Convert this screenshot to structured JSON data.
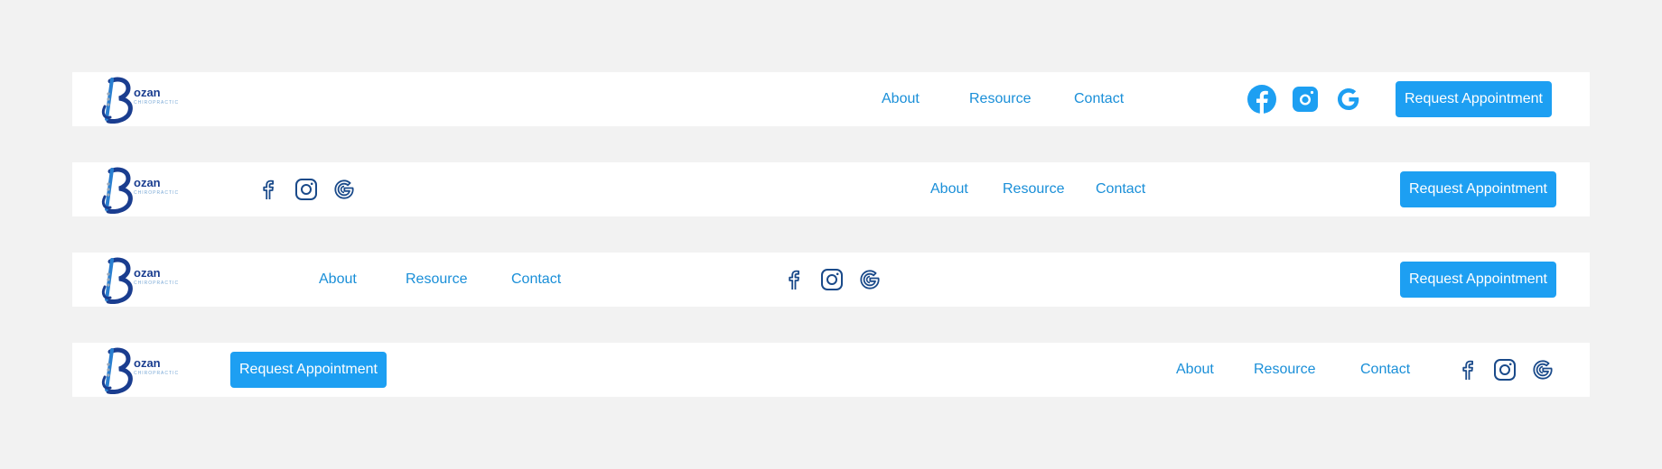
{
  "brand": {
    "logo_letter": "B",
    "logo_name": "ozan",
    "logo_sub": "CHIROPRACTIC"
  },
  "colors": {
    "background": "#f2f2f2",
    "bar": "#ffffff",
    "link": "#1a8fd8",
    "button": "#1d9ff2",
    "logo_dark": "#1a3d8f",
    "icon_blue": "#1d9ff2",
    "icon_dark": "#1a4a8a"
  },
  "variants": [
    {
      "nav": [
        "About",
        "Resource",
        "Contact"
      ],
      "social": [
        "facebook-icon",
        "instagram-icon",
        "google-icon"
      ],
      "cta": "Request Appointment",
      "icon_style": "filled"
    },
    {
      "nav": [
        "About",
        "Resource",
        "Contact"
      ],
      "social": [
        "facebook-icon",
        "instagram-icon",
        "google-icon"
      ],
      "cta": "Request Appointment",
      "icon_style": "outline"
    },
    {
      "nav": [
        "About",
        "Resource",
        "Contact"
      ],
      "social": [
        "facebook-icon",
        "instagram-icon",
        "google-icon"
      ],
      "cta": "Request Appointment",
      "icon_style": "outline"
    },
    {
      "nav": [
        "About",
        "Resource",
        "Contact"
      ],
      "social": [
        "facebook-icon",
        "instagram-icon",
        "google-icon"
      ],
      "cta": "Request Appointment",
      "icon_style": "outline"
    }
  ]
}
